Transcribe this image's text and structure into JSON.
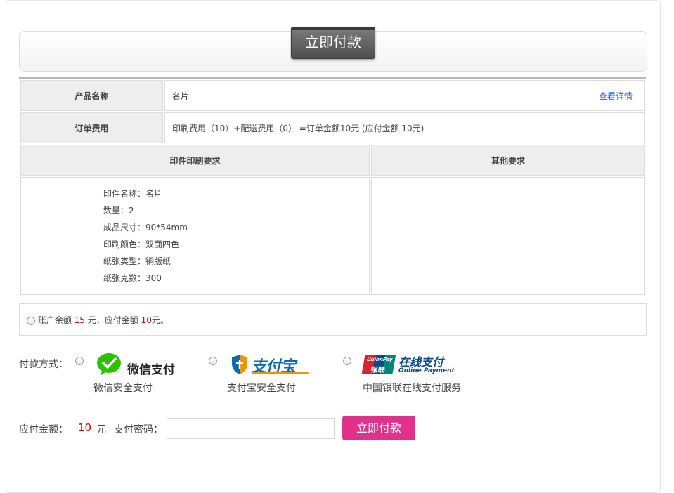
{
  "banner": {
    "title": "立即付款"
  },
  "order": {
    "product_label": "产品名称",
    "product_value": "名片",
    "detail_link": "查看详情",
    "fee_label": "订单费用",
    "fee_value": "印刷费用（10）+配送费用（0） =订单金额10元 (应付金额 10元)"
  },
  "requirements": {
    "print_header": "印件印刷要求",
    "other_header": "其他要求",
    "specs": [
      "印件名称：名片",
      "数量：2",
      "成品尺寸：90*54mm",
      "印刷颜色：双面四色",
      "纸张类型：铜版纸",
      "纸张克数：300"
    ],
    "other_text": ""
  },
  "balance": {
    "prefix": "账户余额",
    "balance_amount": "15",
    "middle": "元，应付金额",
    "due_amount": "10",
    "suffix": "元。"
  },
  "payment": {
    "label": "付款方式：",
    "options": [
      {
        "logo_text": "微信支付",
        "caption": "微信安全支付",
        "icon": "wechat-pay-logo",
        "color": "#2dc100"
      },
      {
        "logo_text": "支付宝",
        "caption": "支付宝安全支付",
        "icon": "alipay-logo",
        "color": "#0b6cb5"
      },
      {
        "logo_text": "在线支付",
        "logo_sub": "Online Payment",
        "badge_top": "UnionPay",
        "badge_bottom": "银联",
        "caption": "中国银联在线支付服务",
        "icon": "unionpay-logo",
        "color": "#0b4a8b"
      }
    ]
  },
  "checkout": {
    "amount_label": "应付金额：",
    "amount_value": "10",
    "amount_unit": "元",
    "password_label": "支付密码：",
    "password_value": "",
    "pay_button": "立即付款"
  },
  "colors": {
    "accent": "#e0318c",
    "highlight": "#d30000",
    "header_bg": "#eeeeee"
  }
}
